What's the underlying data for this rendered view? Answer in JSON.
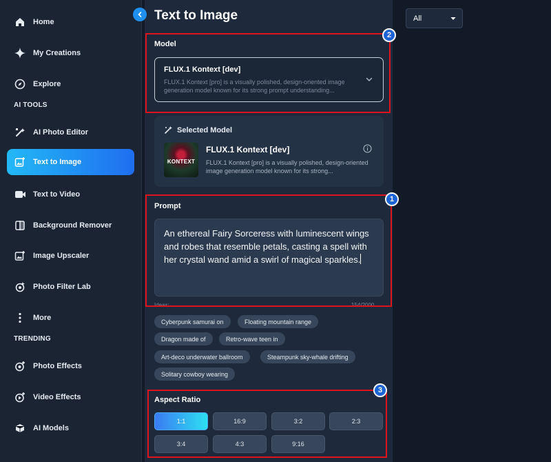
{
  "sidebar": {
    "items": [
      {
        "label": "Home",
        "icon": "home-icon"
      },
      {
        "label": "My Creations",
        "icon": "sparkle-icon"
      },
      {
        "label": "Explore",
        "icon": "compass-icon"
      },
      {
        "label": "AI Photo Editor",
        "icon": "magic-brush-icon"
      },
      {
        "label": "Text to Image",
        "icon": "image-add-icon",
        "active": true
      },
      {
        "label": "Text to Video",
        "icon": "video-camera-icon"
      },
      {
        "label": "Background Remover",
        "icon": "background-remove-icon"
      },
      {
        "label": "Image Upscaler",
        "icon": "image-upscale-icon"
      },
      {
        "label": "Photo Filter Lab",
        "icon": "filter-icon"
      },
      {
        "label": "More",
        "icon": "more-vertical-icon"
      },
      {
        "label": "Photo Effects",
        "icon": "photo-effects-icon"
      },
      {
        "label": "Video Effects",
        "icon": "video-effects-icon"
      },
      {
        "label": "AI Models",
        "icon": "cube-icon"
      }
    ],
    "sections": {
      "ai_tools": "AI TOOLS",
      "trending": "TRENDING"
    }
  },
  "main": {
    "title": "Text to Image",
    "model": {
      "label": "Model",
      "selected_name": "FLUX.1 Kontext [dev]",
      "selected_desc": "FLUX.1 Kontext [pro] is a visually polished, design-oriented image generation model known for its strong prompt understanding..."
    },
    "selected_model": {
      "header": "Selected Model",
      "name": "FLUX.1 Kontext [dev]",
      "desc": "FLUX.1 Kontext [pro] is a visually polished, design-oriented image generation model known for its strong...",
      "thumb_text": "KONTEXT"
    },
    "prompt": {
      "label": "Prompt",
      "value": "An ethereal Fairy Sorceress with luminescent wings and robes that resemble petals, casting a spell with her crystal wand amid a swirl of magical sparkles.",
      "ideas_label": "Ideas:",
      "counter": "154/2000"
    },
    "ideas": [
      "Cyberpunk samurai on",
      "Floating mountain range",
      "Dragon made of",
      "Retro-wave teen in",
      "Art-deco underwater ballroom",
      "Steampunk sky-whale drifting",
      "Solitary cowboy wearing"
    ],
    "aspect_ratio": {
      "label": "Aspect Ratio",
      "options": [
        "1:1",
        "16:9",
        "3:2",
        "2:3",
        "3:4",
        "4:3",
        "9:16"
      ],
      "selected": "1:1"
    }
  },
  "filter": {
    "value": "All"
  },
  "annotations": [
    "1",
    "2",
    "3"
  ],
  "colors": {
    "accent": "#1f8ff0",
    "annotation_red": "#e0121a",
    "badge_blue": "#1c63d6"
  }
}
